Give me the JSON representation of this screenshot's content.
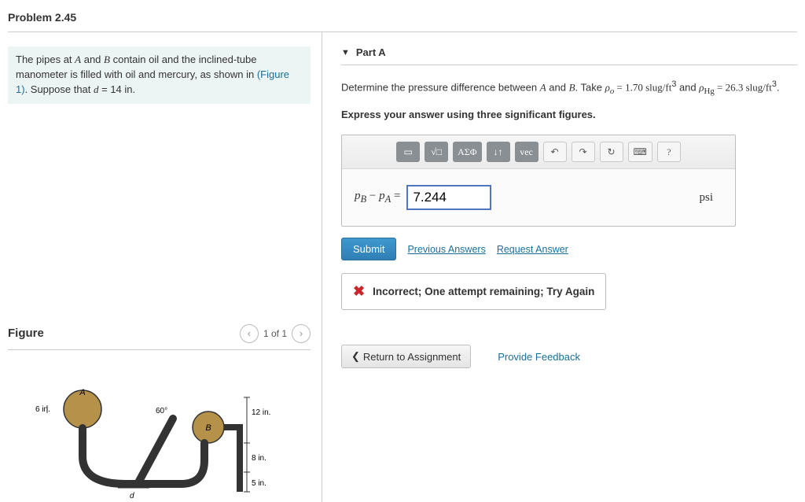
{
  "problem_title": "Problem 2.45",
  "description": {
    "line1_a": "The pipes at ",
    "A": "A",
    "line1_b": " and ",
    "B": "B",
    "line1_c": " contain oil and the inclined-tube manometer is filled with oil and mercury, as shown in ",
    "fig_link": "(Figure 1)",
    "line1_d": ". Suppose that ",
    "dvar": "d",
    "deq": " = 14 in."
  },
  "figure": {
    "title": "Figure",
    "count": "1 of 1",
    "labels": {
      "A": "A",
      "B": "B",
      "d": "d",
      "six": "6 in.",
      "twelve": "12 in.",
      "eight": "8 in.",
      "five": "5 in.",
      "angle": "60°"
    }
  },
  "part": {
    "label": "Part A",
    "prompt_a": "Determine the pressure difference between ",
    "prompt_b": " and ",
    "prompt_c": ". Take ",
    "rho_o": "ρ",
    "rho_o_sub": "o",
    "rho_o_val": " = 1.70 slug/ft",
    "rho_and": " and ",
    "rho_hg": "ρ",
    "rho_hg_sub": "Hg",
    "rho_hg_val": " = 26.3 slug/ft",
    "cube": "3",
    "period": ".",
    "instruction": "Express your answer using three significant figures."
  },
  "toolbar": {
    "tmpl": "▭",
    "frac": "√□",
    "greek": "ΑΣΦ",
    "arrows": "↓↑",
    "vec": "vec",
    "undo": "↶",
    "redo": "↷",
    "reset": "↻",
    "keyboard": "⌨",
    "help": "?"
  },
  "answer": {
    "lhs_pb": "p",
    "lhs_b": "B",
    "minus": " − ",
    "lhs_pa": "p",
    "lhs_a": "A",
    "eq": " = ",
    "value": "7.244",
    "unit": "psi"
  },
  "actions": {
    "submit": "Submit",
    "previous": "Previous Answers",
    "request": "Request Answer"
  },
  "feedback": "Incorrect; One attempt remaining; Try Again",
  "bottom": {
    "chev": "❮",
    "return": " Return to Assignment",
    "provide": "Provide Feedback"
  }
}
